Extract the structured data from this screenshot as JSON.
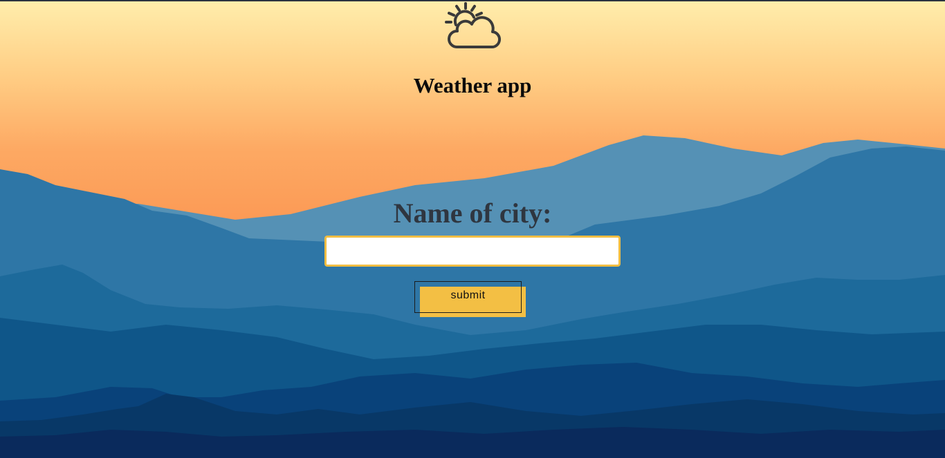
{
  "app": {
    "title": "Weather app",
    "logo_icon": "partly-cloudy-sun-icon"
  },
  "form": {
    "label": "Name of city:",
    "input_value": "",
    "input_placeholder": "",
    "submit_label": "submit"
  },
  "colors": {
    "accent": "#f3bf44",
    "title_text": "#0b0b0b",
    "label_text": "#2f3640",
    "sky_top": "#ffeaa8",
    "sky_bottom": "#fd9a52",
    "mountain_deep": "#0d2a5c"
  },
  "background": {
    "description_icon": "mountain-sunset-background"
  }
}
